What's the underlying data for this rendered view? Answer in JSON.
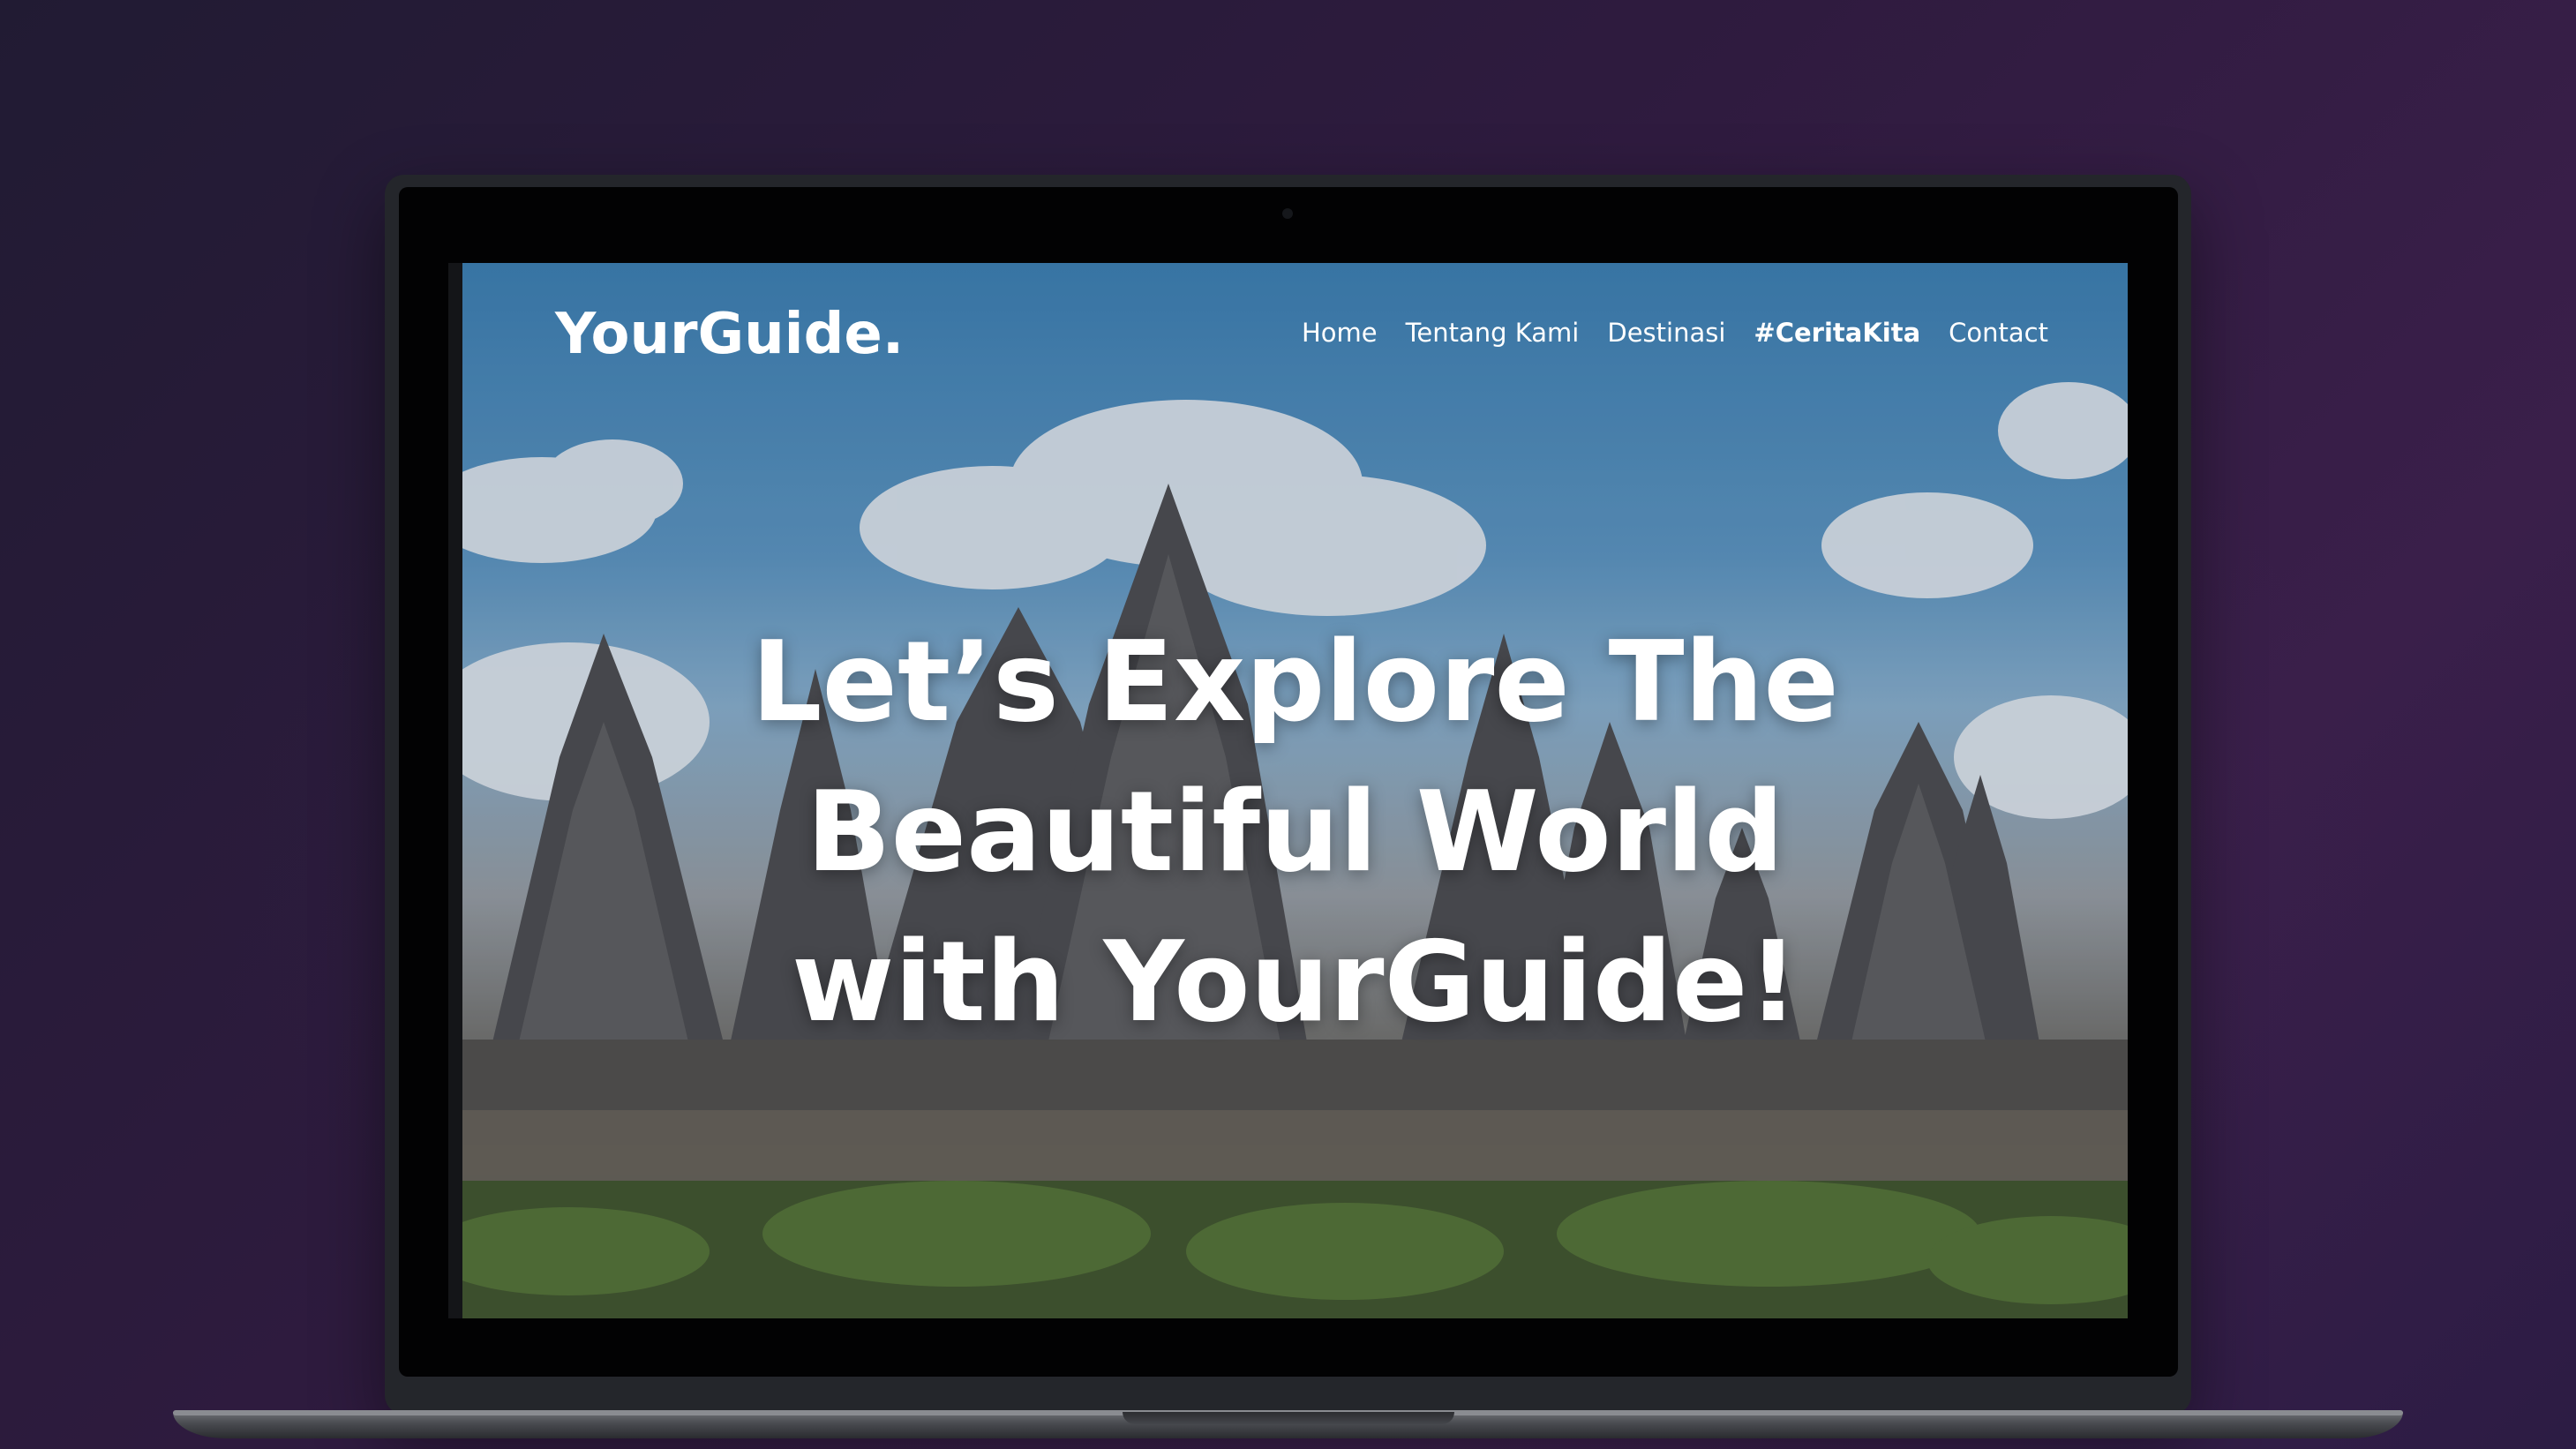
{
  "site": {
    "logo": "YourGuide.",
    "nav": [
      {
        "label": "Home",
        "active": false
      },
      {
        "label": "Tentang Kami",
        "active": false
      },
      {
        "label": "Destinasi",
        "active": false
      },
      {
        "label": "#CeritaKita",
        "active": true
      },
      {
        "label": "Contact",
        "active": false
      }
    ]
  },
  "hero": {
    "headline_lines": [
      "Let’s Explore The",
      "Beautiful World",
      "with YourGuide!"
    ],
    "background_image": "temple-photo"
  },
  "device": {
    "type": "laptop"
  },
  "colors": {
    "background": "#2f1b3f",
    "text": "#ffffff",
    "sky": "#3e82b6"
  }
}
